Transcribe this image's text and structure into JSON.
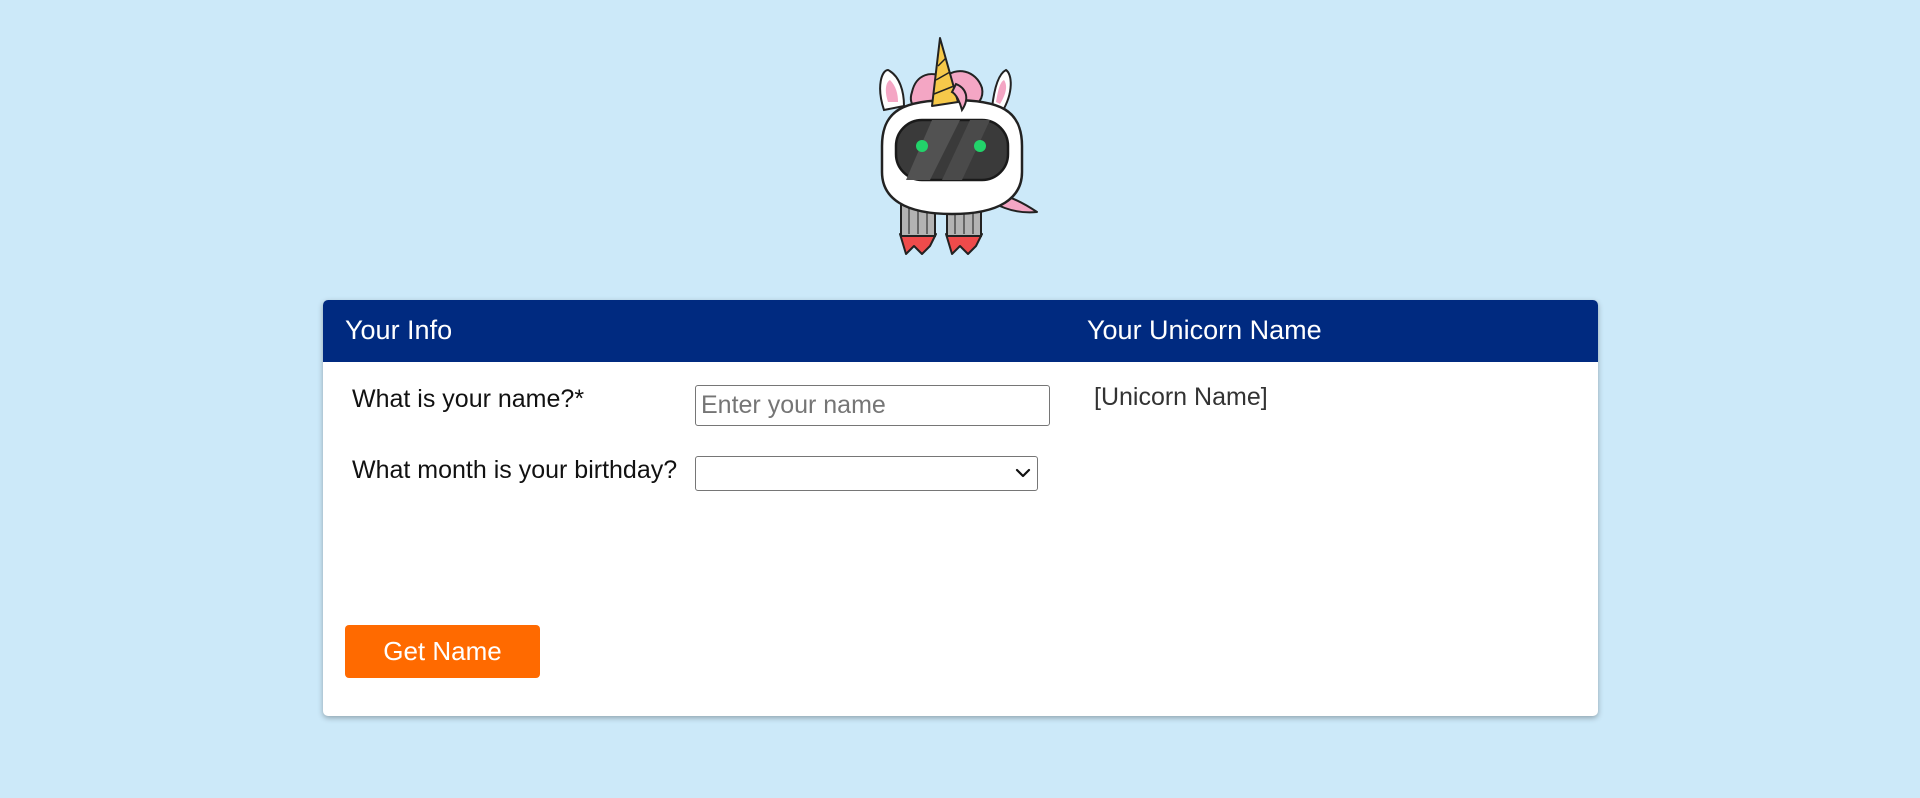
{
  "colors": {
    "background": "#cce9f9",
    "header": "#002a80",
    "button": "#ff6a00"
  },
  "header": {
    "left_title": "Your Info",
    "right_title": "Your Unicorn Name"
  },
  "form": {
    "name_label": "What is your name?*",
    "name_placeholder": "Enter your name",
    "name_value": "",
    "month_label": "What month is your birthday?",
    "month_selected": ""
  },
  "result": {
    "text": "[Unicorn Name]"
  },
  "actions": {
    "get_name_label": "Get Name"
  },
  "icons": {
    "mascot": "unicorn-robot-icon",
    "select_arrow": "chevron-down-icon"
  }
}
